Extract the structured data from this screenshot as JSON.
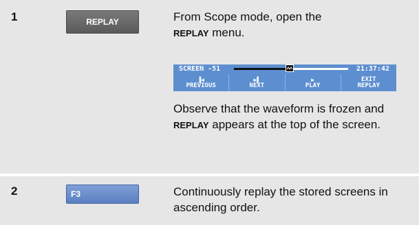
{
  "step1": {
    "number": "1",
    "key_label": "REPLAY",
    "text_before": "From Scope mode, open the ",
    "keyword": "REPLAY",
    "text_after": " menu.",
    "obs_before": "Observe that the waveform is frozen and ",
    "obs_keyword": "REPLAY",
    "obs_after": " appears at the top of the screen."
  },
  "screen": {
    "label": "SCREEN -51",
    "time": "21:37:42",
    "softkeys": [
      {
        "icon": "skip-back-icon",
        "glyph": "◀",
        "label": "PREVIOUS"
      },
      {
        "icon": "skip-forward-icon",
        "glyph": "▶",
        "label": "NEXT"
      },
      {
        "icon": "play-icon",
        "glyph": "▶",
        "label": "PLAY"
      },
      {
        "icon": "",
        "glyph": "",
        "label1": "EXIT",
        "label2": "REPLAY"
      }
    ]
  },
  "step2": {
    "number": "2",
    "key_label": "F3",
    "text": "Continuously replay the stored screens in ascending order."
  },
  "colors": {
    "row_bg": "#e6e6e6",
    "screen_bar": "#5d8fd0",
    "replay_key": "#6a6a6a",
    "f3_key": "#6a8ccb"
  }
}
